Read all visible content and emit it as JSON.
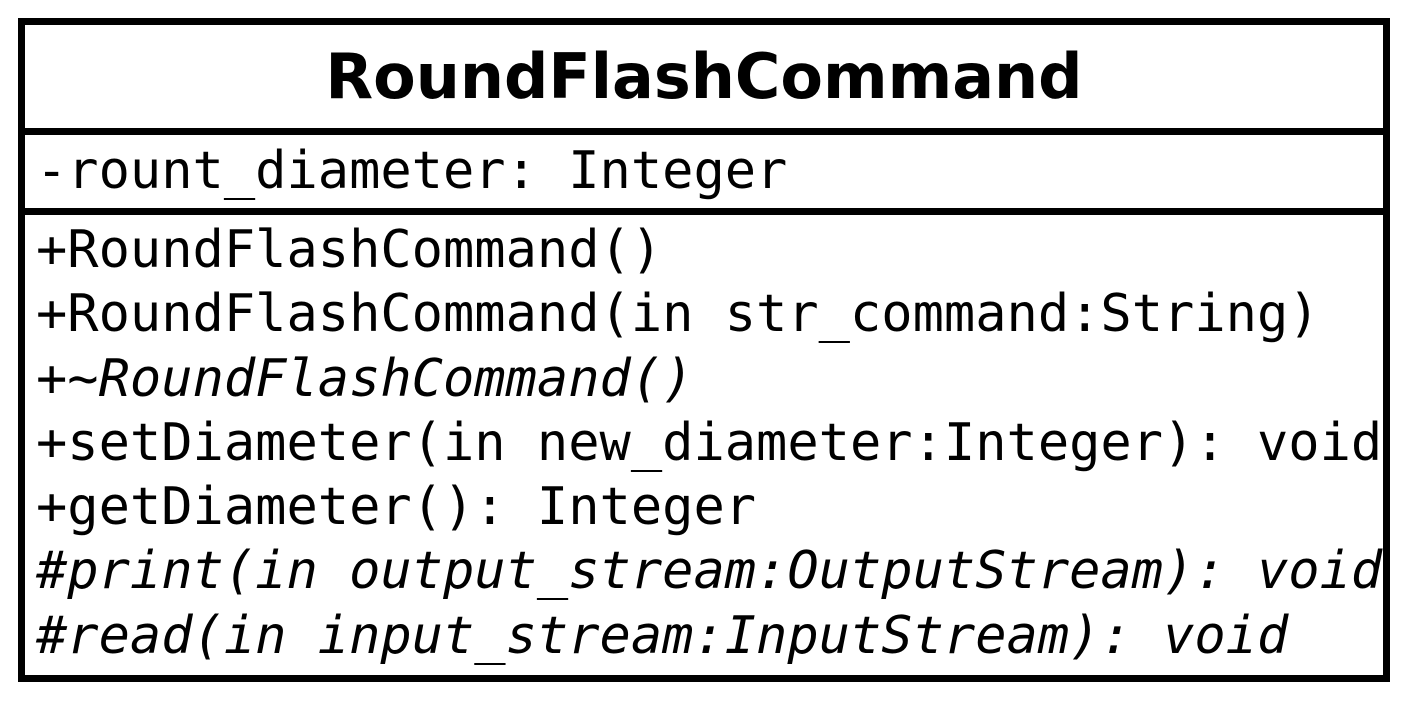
{
  "class": {
    "name": "RoundFlashCommand",
    "attributes": [
      {
        "text": "-rount_diameter: Integer",
        "italic": false
      }
    ],
    "operations": [
      {
        "text": "+RoundFlashCommand()",
        "italic": false
      },
      {
        "text": "+RoundFlashCommand(in str_command:String)",
        "italic": false
      },
      {
        "text": "+~RoundFlashCommand()",
        "italic": true
      },
      {
        "text": "+setDiameter(in new_diameter:Integer): void",
        "italic": false
      },
      {
        "text": "+getDiameter(): Integer",
        "italic": false
      },
      {
        "text": "#print(in output_stream:OutputStream): void",
        "italic": true
      },
      {
        "text": "#read(in input_stream:InputStream): void",
        "italic": true
      }
    ]
  },
  "colors": {
    "border": "#000000",
    "background": "#ffffff",
    "text": "#000000"
  }
}
